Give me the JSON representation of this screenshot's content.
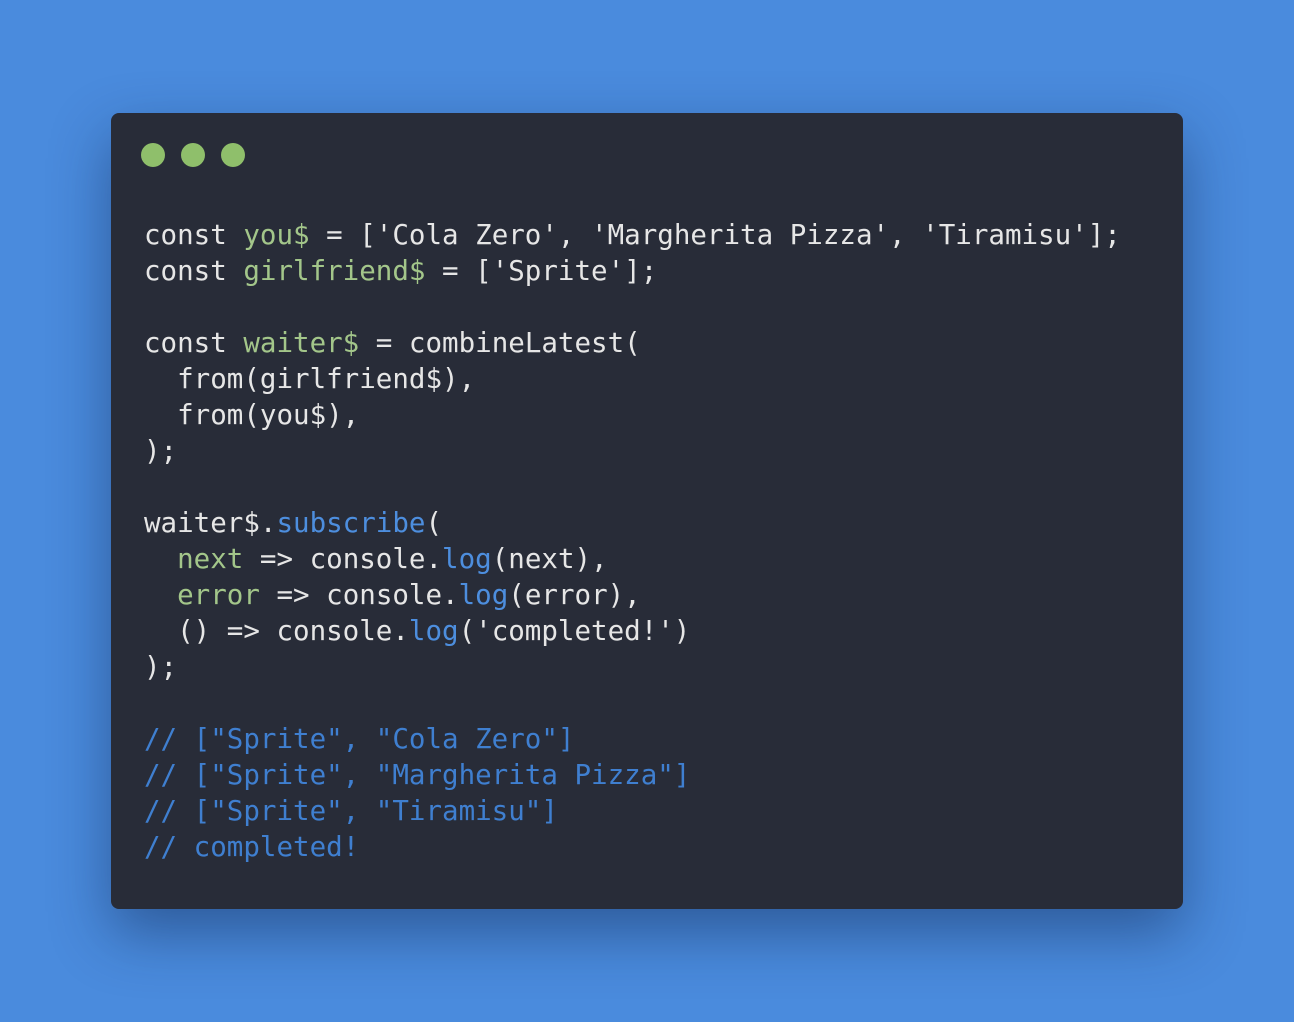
{
  "colors": {
    "background": "#4a8bdd",
    "window": "#282c38",
    "window_dot": "#8fbf6b",
    "text": "#e6e6e6",
    "variable": "#a3c68a",
    "method": "#4d8ede",
    "comment": "#3f7fd0"
  },
  "window_controls": [
    "dot",
    "dot",
    "dot"
  ],
  "code_lines": [
    [
      {
        "t": "const ",
        "k": "text"
      },
      {
        "t": "you$",
        "k": "variable"
      },
      {
        "t": " = ['Cola Zero', 'Margherita Pizza', 'Tiramisu'];",
        "k": "text"
      }
    ],
    [
      {
        "t": "const ",
        "k": "text"
      },
      {
        "t": "girlfriend$",
        "k": "variable"
      },
      {
        "t": " = ['Sprite'];",
        "k": "text"
      }
    ],
    [],
    [
      {
        "t": "const ",
        "k": "text"
      },
      {
        "t": "waiter$",
        "k": "variable"
      },
      {
        "t": " = combineLatest(",
        "k": "text"
      }
    ],
    [
      {
        "t": "  from(girlfriend$),",
        "k": "text"
      }
    ],
    [
      {
        "t": "  from(you$),",
        "k": "text"
      }
    ],
    [
      {
        "t": ");",
        "k": "text"
      }
    ],
    [],
    [
      {
        "t": "waiter$.",
        "k": "text"
      },
      {
        "t": "subscribe",
        "k": "method"
      },
      {
        "t": "(",
        "k": "text"
      }
    ],
    [
      {
        "t": "  ",
        "k": "text"
      },
      {
        "t": "next",
        "k": "variable"
      },
      {
        "t": " => console.",
        "k": "text"
      },
      {
        "t": "log",
        "k": "method"
      },
      {
        "t": "(next),",
        "k": "text"
      }
    ],
    [
      {
        "t": "  ",
        "k": "text"
      },
      {
        "t": "error",
        "k": "variable"
      },
      {
        "t": " => console.",
        "k": "text"
      },
      {
        "t": "log",
        "k": "method"
      },
      {
        "t": "(error),",
        "k": "text"
      }
    ],
    [
      {
        "t": "  () => console.",
        "k": "text"
      },
      {
        "t": "log",
        "k": "method"
      },
      {
        "t": "('completed!')",
        "k": "text"
      }
    ],
    [
      {
        "t": ");",
        "k": "text"
      }
    ],
    [],
    [
      {
        "t": "// [\"Sprite\", \"Cola Zero\"]",
        "k": "comment"
      }
    ],
    [
      {
        "t": "// [\"Sprite\", \"Margherita Pizza\"]",
        "k": "comment"
      }
    ],
    [
      {
        "t": "// [\"Sprite\", \"Tiramisu\"]",
        "k": "comment"
      }
    ],
    [
      {
        "t": "// completed!",
        "k": "comment"
      }
    ]
  ]
}
